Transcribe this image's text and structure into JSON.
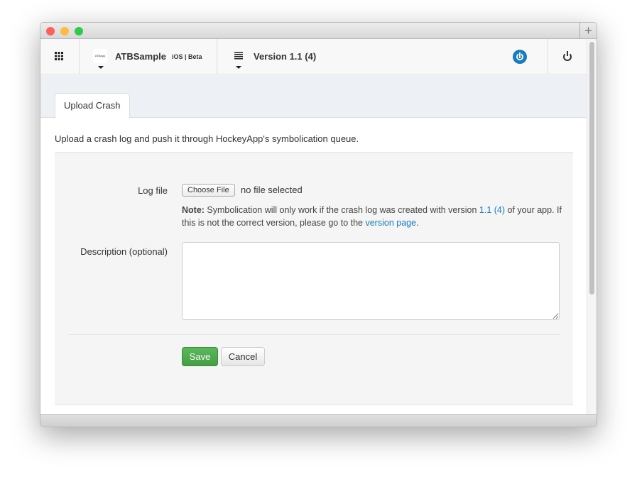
{
  "window": {
    "new_tab": "+"
  },
  "nav": {
    "app_name": "ATBSample",
    "app_platform": "iOS | Beta",
    "app_icon_text": "ATBApp",
    "version": "Version 1.1 (4)"
  },
  "tabs": [
    {
      "label": "Upload Crash",
      "active": true
    }
  ],
  "intro": "Upload a crash log and push it through HockeyApp's symbolication queue.",
  "form": {
    "log_file_label": "Log file",
    "choose_file": "Choose File",
    "file_status": "no file selected",
    "note_bold": "Note:",
    "note_1": " Symbolication will only work if the crash log was created with version ",
    "note_version": "1.1 (4)",
    "note_2": " of your app. If this is not the correct version, please go to the ",
    "note_link": "version page",
    "note_3": ".",
    "description_label": "Description (optional)",
    "description_value": "",
    "save": "Save",
    "cancel": "Cancel"
  },
  "colors": {
    "accent": "#1a7bbf",
    "save": "#4cae4c"
  }
}
